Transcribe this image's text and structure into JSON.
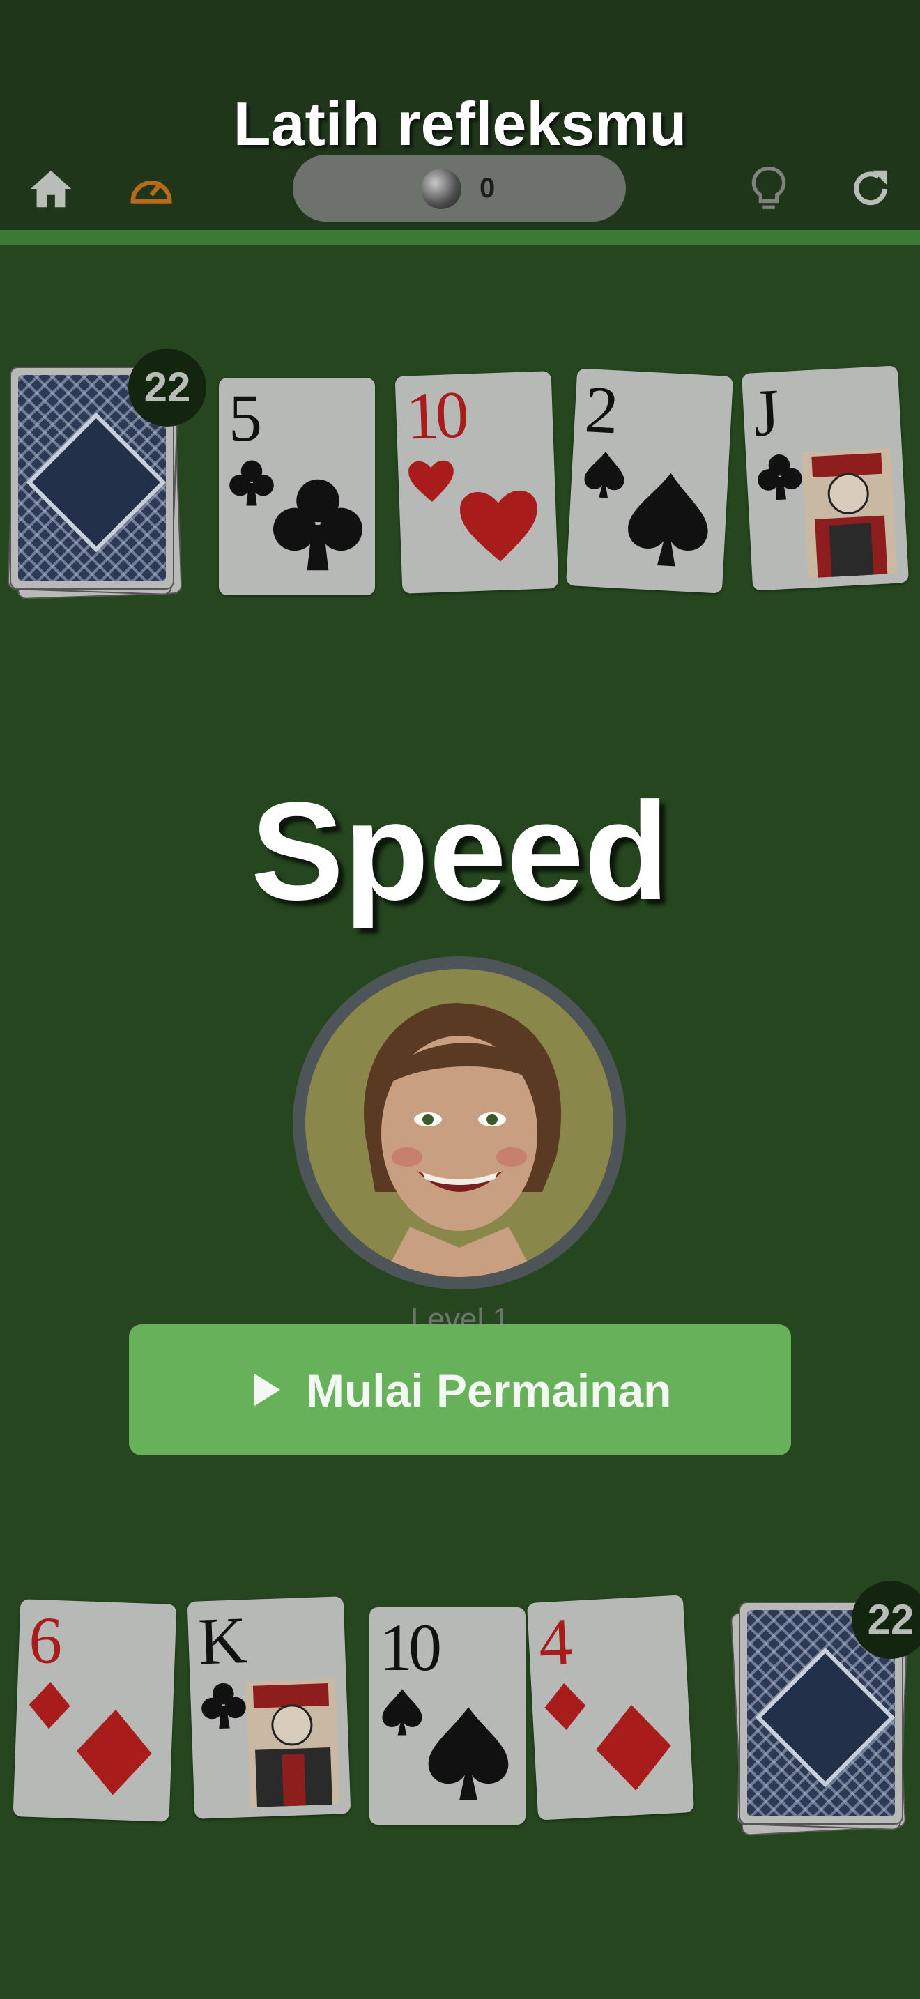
{
  "header": {
    "tagline": "Latih refleksmu",
    "coins": "0",
    "icons": [
      "home-icon",
      "speedometer-icon",
      "coin-icon",
      "lightbulb-icon",
      "refresh-icon"
    ]
  },
  "opponent": {
    "deck_count": "22",
    "cards": [
      {
        "rank": "5",
        "suit": "clubs"
      },
      {
        "rank": "10",
        "suit": "hearts"
      },
      {
        "rank": "2",
        "suit": "spades"
      },
      {
        "rank": "J",
        "suit": "clubs"
      }
    ]
  },
  "center": {
    "game_title": "Speed",
    "level": "Level 1",
    "start_label": "Mulai Permainan"
  },
  "player": {
    "deck_count": "22",
    "cards": [
      {
        "rank": "6",
        "suit": "diamonds"
      },
      {
        "rank": "K",
        "suit": "clubs"
      },
      {
        "rank": "10",
        "suit": "spades"
      },
      {
        "rank": "4",
        "suit": "diamonds"
      }
    ]
  },
  "colors": {
    "table": "#25461f",
    "header": "#1f361b",
    "accent_line": "#3b7a32",
    "button": "#68b15b",
    "speed_icon": "#b86a1c",
    "suit_red": "#a81c1c"
  }
}
